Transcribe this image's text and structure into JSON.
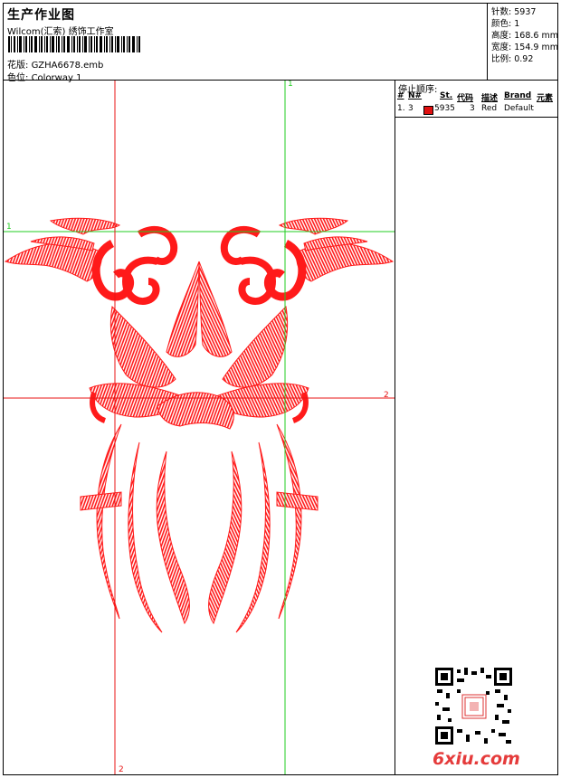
{
  "header": {
    "title": "生产作业图",
    "company": "Wilcom(汇索) 绣饰工作室",
    "design_label": "花版:",
    "design_value": "GZHA6678.emb",
    "colorway_label": "色位:",
    "colorway_value": "Colorway 1"
  },
  "stats": [
    {
      "label": "针数:",
      "value": "5937"
    },
    {
      "label": "颜色:",
      "value": "1"
    },
    {
      "label": "高度:",
      "value": "168.6 mm"
    },
    {
      "label": "宽度:",
      "value": "154.9 mm"
    },
    {
      "label": "比例:",
      "value": "0.92"
    }
  ],
  "stop_sequence": {
    "title": "停止顺序:",
    "headers": {
      "hash": "#",
      "no": "N#",
      "st": "St.",
      "code": "代码",
      "desc": "描述",
      "brand": "Brand",
      "element": "元素"
    },
    "rows": [
      {
        "index": "1.",
        "no": "3",
        "st": "5935",
        "code": "3",
        "desc": "Red",
        "brand": "Default",
        "color": "#e01010"
      }
    ]
  },
  "guides": {
    "v1_label": "1",
    "h1_label": "1",
    "h2_label": "2",
    "v2_label": "2"
  },
  "colors": {
    "thread": "#ff1a1a",
    "guide_green": "#22cc22",
    "guide_red": "#e81515"
  },
  "watermark": "6xiu.com"
}
